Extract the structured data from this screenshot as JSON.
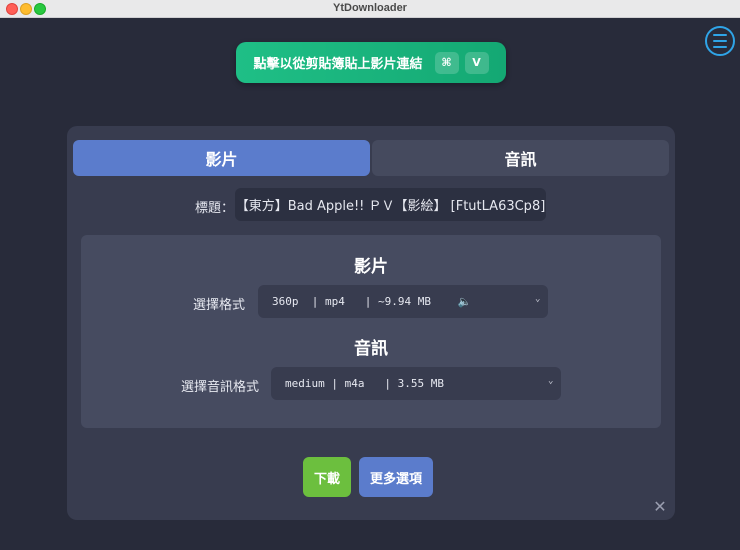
{
  "window": {
    "title": "YtDownloader"
  },
  "menu": {
    "icon": "hamburger-menu-icon"
  },
  "paste_button": {
    "label": "點擊以從剪貼簿貼上影片連結",
    "key1": "⌘",
    "key2": "V"
  },
  "tabs": [
    {
      "label": "影片",
      "active": true
    },
    {
      "label": "音訊",
      "active": false
    }
  ],
  "title_row": {
    "label": "標題：",
    "value": "【東方】Bad Apple!! ＰＶ【影絵】 [FtutLA63Cp8]"
  },
  "video_section": {
    "heading": "影片",
    "format_label": "選擇格式",
    "format_value": "360p  | mp4   | ~9.94 MB    ",
    "mute_icon": "🔈"
  },
  "audio_section": {
    "heading": "音訊",
    "format_label": "選擇音訊格式",
    "format_value": "medium | m4a   | 3.55 MB"
  },
  "actions": {
    "download": "下載",
    "more_options": "更多選項"
  },
  "colors": {
    "accent_blue": "#5b7ccc",
    "green": "#6cbf3e",
    "paste_green": "#1fbf86",
    "menu_blue": "#2fa4e7"
  }
}
